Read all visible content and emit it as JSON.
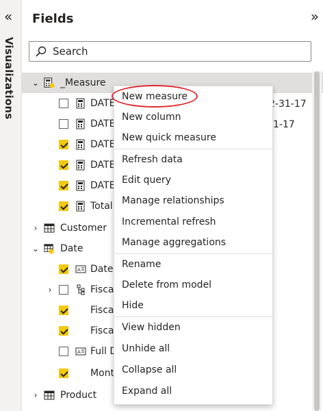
{
  "viz_panel": {
    "collapse_glyph": "«",
    "label": "Visualizations"
  },
  "fields_panel": {
    "title": "Fields",
    "expand_glyph": "»",
    "search_placeholder": "Search"
  },
  "tree": {
    "measure_table": "_Measure",
    "measure_rows": [
      {
        "label": "DATE",
        "checked": false,
        "tail": "2-31-17"
      },
      {
        "label": "DATE",
        "checked": false,
        "tail": "1-17"
      },
      {
        "label": "DATE",
        "checked": true
      },
      {
        "label": "DATE",
        "checked": true
      },
      {
        "label": "DATE",
        "checked": true
      },
      {
        "label": "Total",
        "checked": true
      }
    ],
    "customer_table": "Customer",
    "date_table": "Date",
    "date_rows": [
      {
        "label": "Date",
        "checked": true
      },
      {
        "label": "Fisca",
        "checked": false
      },
      {
        "label": "Fisca",
        "checked": true
      },
      {
        "label": "Fisca",
        "checked": true
      },
      {
        "label": "Full D",
        "checked": false
      },
      {
        "label": "Mont",
        "checked": true
      }
    ],
    "product_table": "Product"
  },
  "context_menu": {
    "groups": [
      [
        "New measure",
        "New column",
        "New quick measure"
      ],
      [
        "Refresh data",
        "Edit query",
        "Manage relationships",
        "Incremental refresh",
        "Manage aggregations"
      ],
      [
        "Rename",
        "Delete from model",
        "Hide"
      ],
      [
        "View hidden",
        "Unhide all",
        "Collapse all",
        "Expand all"
      ]
    ]
  },
  "colors": {
    "checkbox_on": "#f2c811",
    "annotation_ring": "#e0282d",
    "highlight_row": "#e1dfdd"
  }
}
